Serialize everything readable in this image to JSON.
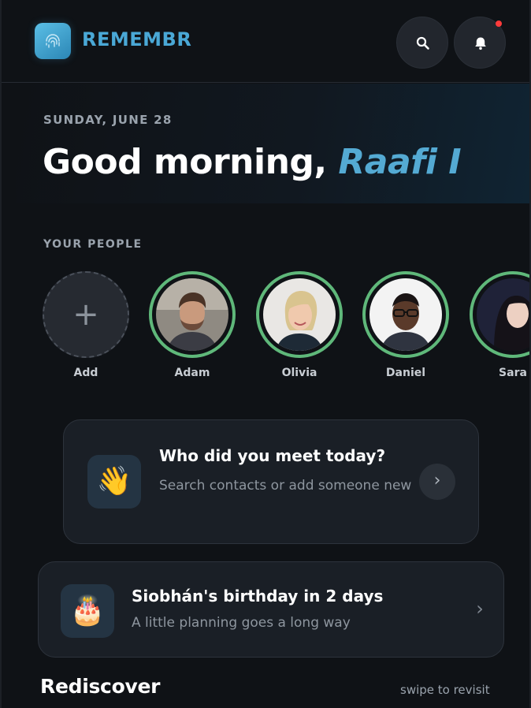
{
  "app": {
    "brand": "REMEMBR",
    "accent_color": "#4aa8d6",
    "logo_icon": "fingerprint-icon",
    "header_buttons": [
      {
        "icon": "search-icon"
      },
      {
        "icon": "bell-icon",
        "has_notification": true
      }
    ]
  },
  "hero": {
    "date": "SUNDAY, JUNE 28",
    "greeting_prefix": "Good morning, ",
    "user_name": "Raafi I"
  },
  "people": {
    "label": "YOUR PEOPLE",
    "add_label": "Add",
    "ring_color": "#5fb87a",
    "contacts": [
      {
        "name": "Adam"
      },
      {
        "name": "Olivia"
      },
      {
        "name": "Daniel"
      },
      {
        "name": "Sara"
      }
    ]
  },
  "meet_card": {
    "emoji": "👋",
    "title": "Who did you meet today?",
    "subtitle": "Search contacts or add someone new"
  },
  "birthday_card": {
    "emoji": "🎂",
    "title": "Siobhán's birthday in 2 days",
    "subtitle": "A little planning goes a long way"
  },
  "rediscover": {
    "title": "Rediscover",
    "hint": "swipe to revisit"
  }
}
